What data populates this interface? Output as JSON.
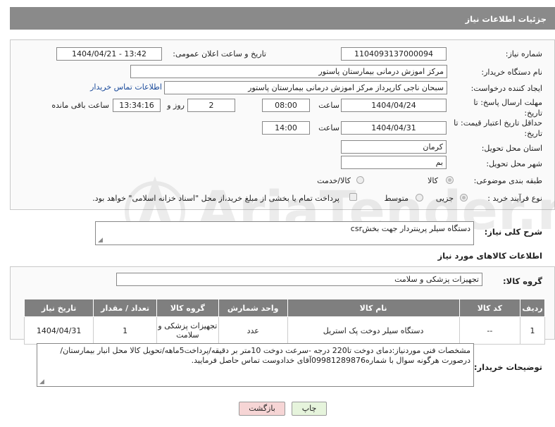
{
  "header": {
    "title": "جزئیات اطلاعات نیاز"
  },
  "form": {
    "need_number_label": "شماره نیاز:",
    "need_number": "1104093137000094",
    "announce_label": "تاریخ و ساعت اعلان عمومی:",
    "announce_value": "1404/04/21 - 13:42",
    "buyer_org_label": "نام دستگاه خریدار:",
    "buyer_org": "مرکز اموزش درمانی بیمارستان پاستور",
    "creator_label": "ایجاد کننده درخواست:",
    "creator": "سبحان ناجی کارپرداز مرکز اموزش درمانی بیمارستان پاستور",
    "buyer_contact_link": "اطلاعات تماس خریدار",
    "reply_deadline_label": "مهلت ارسال پاسخ: تا تاریخ:",
    "reply_date": "1404/04/24",
    "time_label": "ساعت",
    "reply_time": "08:00",
    "days": "2",
    "days_label": "روز و",
    "remaining_time": "13:34:16",
    "remaining_label": "ساعت باقی مانده",
    "price_validity_label": "حداقل تاریخ اعتبار قیمت: تا تاریخ:",
    "price_date": "1404/04/31",
    "price_time": "14:00",
    "province_label": "استان محل تحویل:",
    "province": "کرمان",
    "city_label": "شهر محل تحویل:",
    "city": "بم",
    "category_label": "طبقه بندی موضوعی:",
    "category_options": [
      "کالا",
      "کالا/خدمت"
    ],
    "process_label": "نوع فرآیند خرید :",
    "process_options": [
      "جزیی",
      "متوسط"
    ],
    "payment_note": "پرداخت تمام یا بخشی از مبلغ خرید،از محل \"اسناد خزانه اسلامی\" خواهد بود."
  },
  "description": {
    "label": "شرح کلی نیاز:",
    "text": "دستگاه سیلر پرینتردار جهت بخشcsr"
  },
  "goods": {
    "section_title": "اطلاعات کالاهای مورد نیاز",
    "group_label": "گروه کالا:",
    "group_value": "تجهیزات پزشکی و سلامت",
    "columns": [
      "ردیف",
      "کد کالا",
      "نام کالا",
      "واحد شمارش",
      "گروه کالا",
      "تعداد / مقدار",
      "تاریخ نیاز"
    ],
    "rows": [
      [
        "1",
        "--",
        "دستگاه سیلر دوخت پک استریل",
        "عدد",
        "تجهیزات پزشکی و سلامت",
        "1",
        "1404/04/31"
      ]
    ]
  },
  "buyer_notes": {
    "label": "توضیحات خریدار:",
    "text": "مشخصات فنی موردنیاز:دمای دوخت تا220 درجه -سرعت دوخت 10متر بر دقیقه/پرداخت5ماهه/تحویل کالا محل انبار بیمارستان/درصورت هرگونه سوال با شماره09981289876آقای خدادوست تماس حاصل فرمایید."
  },
  "buttons": {
    "print": "چاپ",
    "back": "بازگشت"
  },
  "watermark": {
    "text": "AriaTender.net"
  },
  "colors": {
    "header": "#8a8a8a",
    "table_header": "#7f7f7f",
    "link": "#1a4a9a",
    "back_button": "#f6d5d5",
    "print_button": "#e6f4dc"
  }
}
